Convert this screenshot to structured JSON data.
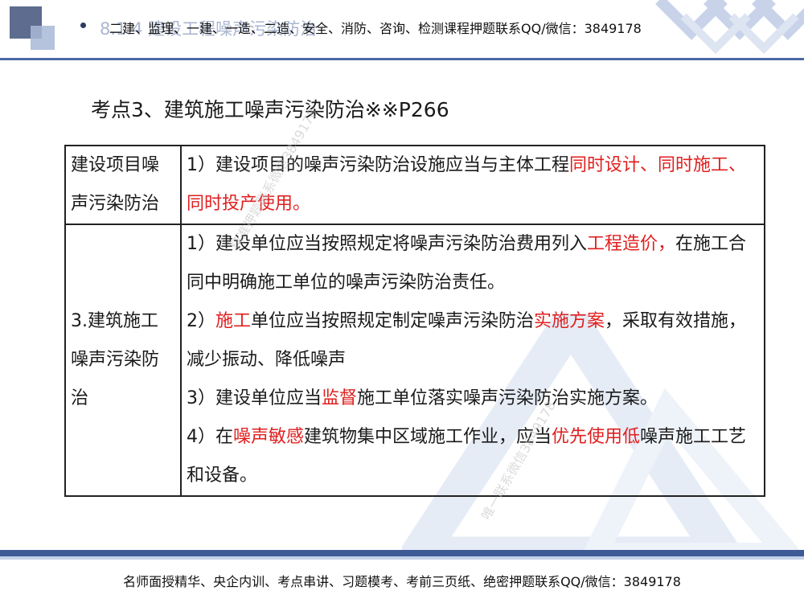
{
  "header": {
    "title": "8.1.4 建设工程噪声污染防治",
    "contact": "二建、监理、一建、一造、二造、安全、消防、咨询、检测课程押题联系QQ/微信：3849178"
  },
  "section": {
    "title": "考点3、建筑施工噪声污染防治※※P266"
  },
  "table": {
    "row1": {
      "category": "建设项目噪声污染防治",
      "line1_text": "1）建设项目的噪声污染防治设施应当与主体工程",
      "line1_red": "同时设计、同时施工、同时投产使用。"
    },
    "row2": {
      "category": "3.建筑施工噪声污染防治",
      "item1_text": "1）建设单位应当按照规定将噪声污染防治费用列入",
      "item1_red": "工程造价，",
      "item1_tail": "在施工合同中明确施工单位的噪声污染防治责任。",
      "item2_pre": "2）",
      "item2_red1": "施工",
      "item2_mid": "单位应当按照规定制定噪声污染防治",
      "item2_red2": "实施方案",
      "item2_tail": "，采取有效措施，减少振动、降低噪声",
      "item3_pre": "3）建设单位应当",
      "item3_red": "监督",
      "item3_tail": "施工单位落实噪声污染防治实施方案。",
      "item4_pre": "4）在",
      "item4_red1": "噪声敏感",
      "item4_mid": "建筑物集中区域施工作业，应当",
      "item4_red2": "优先使用低",
      "item4_tail": "噪声施工工艺和设备。"
    }
  },
  "watermarks": {
    "wm1": "精准押题联系微信3849178",
    "wm2": "唯一联系微信3849178"
  },
  "footer": {
    "text": "名师面授精华、央企内训、考点串讲、习题模考、考前三页纸、绝密押题联系QQ/微信：3849178"
  },
  "colors": {
    "accent_red": "#e01f1f",
    "header_blue": "#4a6aa5",
    "footer_blue": "#3d5a96"
  }
}
